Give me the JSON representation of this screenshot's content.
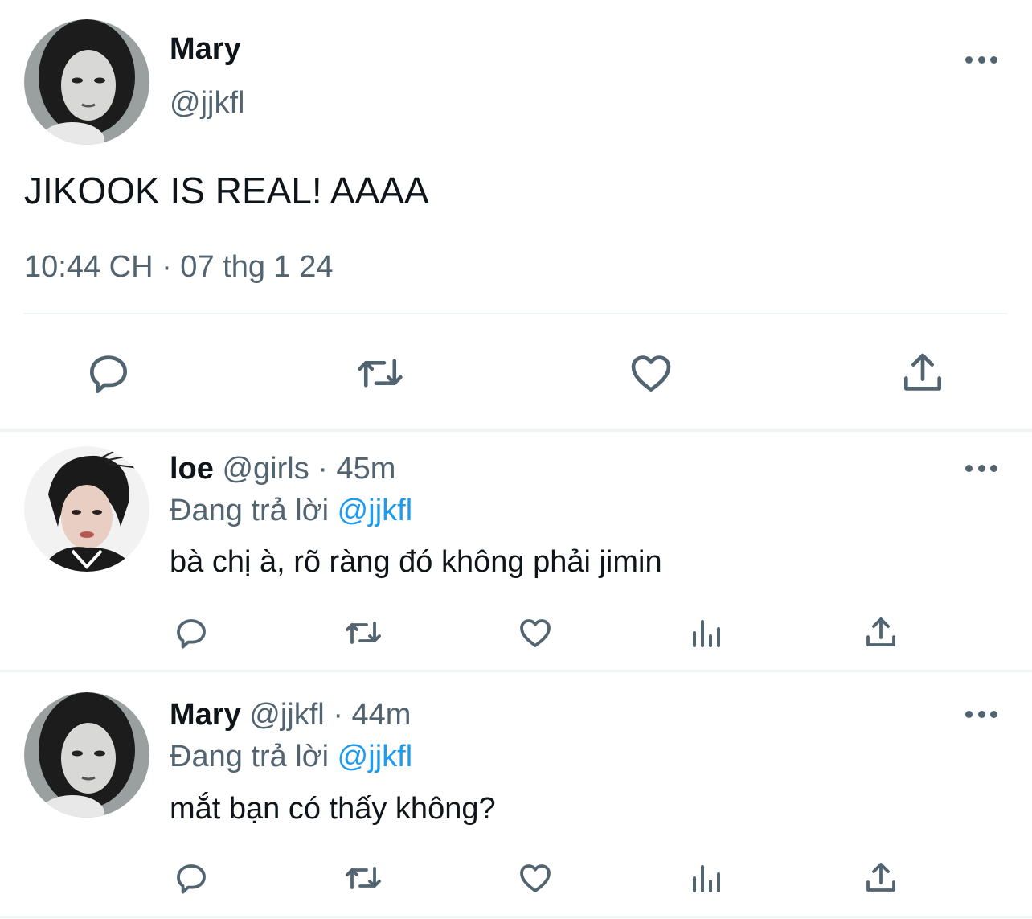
{
  "main_tweet": {
    "display_name": "Mary",
    "handle": "@jjkfl",
    "text": "JIKOOK IS REAL! AAAA",
    "timestamp": "10:44 CH · 07 thg 1 24",
    "actions": [
      "reply-icon",
      "retweet-icon",
      "like-icon",
      "share-icon"
    ]
  },
  "replies": [
    {
      "display_name": "loe",
      "handle": "@girls",
      "separator": "·",
      "time": "45m",
      "replying_prefix": "Đang trả lời",
      "replying_to": "@jjkfl",
      "text": "bà chị à, rõ ràng đó không phải jimin",
      "actions": [
        "reply-icon",
        "retweet-icon",
        "like-icon",
        "views-icon",
        "share-icon"
      ]
    },
    {
      "display_name": "Mary",
      "handle": "@jjkfl",
      "separator": "·",
      "time": "44m",
      "replying_prefix": "Đang trả lời",
      "replying_to": "@jjkfl",
      "text": "mắt bạn có thấy không?",
      "actions": [
        "reply-icon",
        "retweet-icon",
        "like-icon",
        "views-icon",
        "share-icon"
      ]
    }
  ],
  "colors": {
    "text_primary": "#0f1419",
    "text_secondary": "#536471",
    "link": "#1d9bf0",
    "divider": "#eff3f4"
  }
}
